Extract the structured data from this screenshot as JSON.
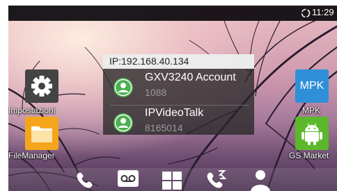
{
  "status_bar": {
    "time": "11:29",
    "sync_icon": "sync-icon"
  },
  "widget": {
    "ip_label": "IP:192.168.40.134",
    "accounts": [
      {
        "name": "GXV3240 Account",
        "number": "1088",
        "icon": "contact-icon",
        "color": "#4caf50"
      },
      {
        "name": "IPVideoTalk",
        "number": "8165014",
        "icon": "contact-icon",
        "color": "#4caf50"
      }
    ]
  },
  "apps": {
    "settings": {
      "label": "Impostazioni",
      "icon": "gear-icon"
    },
    "file_manager": {
      "label": "FileManager",
      "icon": "folder-icon"
    },
    "mpk": {
      "label": "MPK",
      "tile_text": "MPK",
      "icon": "mpk-icon"
    },
    "gs_market": {
      "label": "GS Market",
      "icon": "android-icon"
    }
  },
  "dock": [
    {
      "name": "phone",
      "icon": "phone-icon"
    },
    {
      "name": "voicemail",
      "icon": "voicemail-icon"
    },
    {
      "name": "apps",
      "icon": "apps-grid-icon"
    },
    {
      "name": "call-history",
      "icon": "call-history-icon"
    },
    {
      "name": "contacts",
      "icon": "contacts-icon"
    }
  ],
  "colors": {
    "status_bar": "#0a080c",
    "account_badge": "#4caf50",
    "mpk_tile": "#2f8fd8",
    "gs_market_tile": "#5bb82a",
    "file_manager_tile": "#f5a51c",
    "settings_tile": "#444444"
  }
}
